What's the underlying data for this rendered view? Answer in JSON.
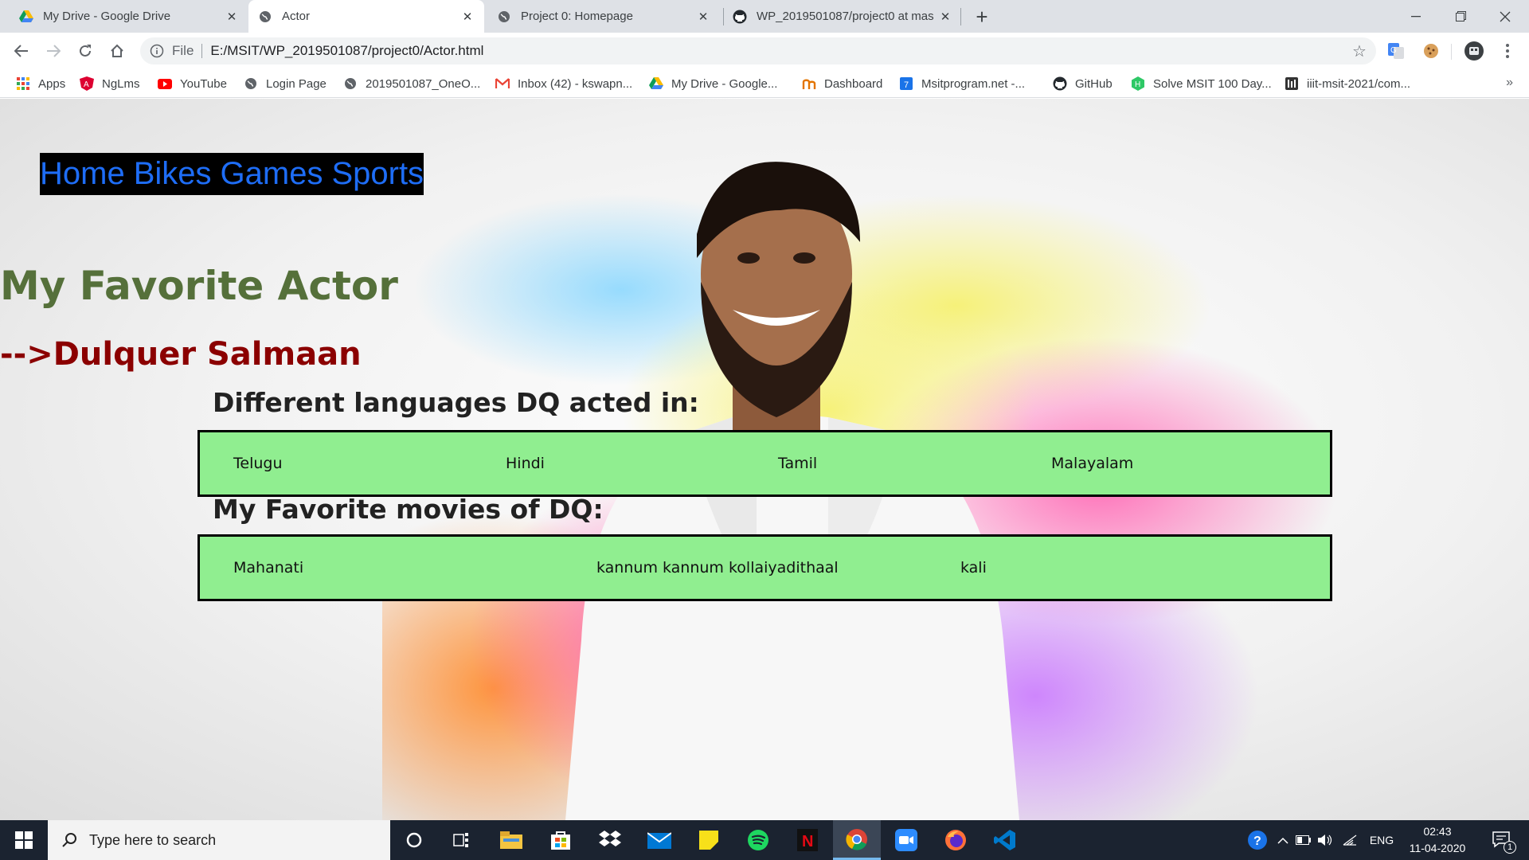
{
  "browser": {
    "tabs": [
      {
        "title": "My Drive - Google Drive",
        "icon": "google-drive-icon",
        "active": false
      },
      {
        "title": "Actor",
        "icon": "globe-icon",
        "active": true
      },
      {
        "title": "Project 0: Homepage",
        "icon": "globe-icon",
        "active": false
      },
      {
        "title": "WP_2019501087/project0 at mas",
        "icon": "github-icon",
        "active": false
      }
    ],
    "address": {
      "scheme_label": "File",
      "url": "E:/MSIT/WP_2019501087/project0/Actor.html"
    },
    "bookmarks": [
      {
        "label": "Apps",
        "icon": "apps-grid-icon"
      },
      {
        "label": "NgLms",
        "icon": "angular-icon"
      },
      {
        "label": "YouTube",
        "icon": "youtube-icon"
      },
      {
        "label": "Login Page",
        "icon": "globe-icon"
      },
      {
        "label": "2019501087_OneO...",
        "icon": "globe-icon"
      },
      {
        "label": "Inbox (42) - kswapn...",
        "icon": "gmail-icon"
      },
      {
        "label": "My Drive - Google...",
        "icon": "google-drive-icon"
      },
      {
        "label": "Dashboard",
        "icon": "dashboard-icon"
      },
      {
        "label": "Msitprogram.net -...",
        "icon": "calendar-icon"
      },
      {
        "label": "GitHub",
        "icon": "github-icon"
      },
      {
        "label": "Solve MSIT 100 Day...",
        "icon": "hackerrank-icon"
      },
      {
        "label": "iiit-msit-2021/com...",
        "icon": "repo-icon"
      }
    ],
    "bookmarks_more": "»"
  },
  "page": {
    "nav": [
      "Home",
      "Bikes",
      "Games",
      "Sports"
    ],
    "heading": "My Favorite Actor",
    "actor": "-->Dulquer Salmaan",
    "languages_heading": "Different languages DQ acted in:",
    "languages": [
      "Telugu",
      "Hindi",
      "Tamil",
      "Malayalam"
    ],
    "movies_heading": "My Favorite movies of DQ:",
    "movies": [
      "Mahanati",
      "kannum kannum kollaiyadithaal",
      "kali"
    ]
  },
  "taskbar": {
    "search_placeholder": "Type here to search",
    "apps": [
      "cortana-icon",
      "task-view-icon",
      "file-explorer-icon",
      "store-icon",
      "dropbox-icon",
      "mail-icon",
      "sticky-notes-icon",
      "spotify-icon",
      "netflix-icon",
      "chrome-icon",
      "zoom-icon",
      "firefox-icon",
      "vscode-icon"
    ],
    "language": "ENG",
    "time": "02:43",
    "date": "11-04-2020",
    "notification_count": "1"
  },
  "colors": {
    "nav_link": "#1e6df6",
    "heading": "#55703a",
    "actor": "#8b0000",
    "box_fill": "#90ee90"
  }
}
